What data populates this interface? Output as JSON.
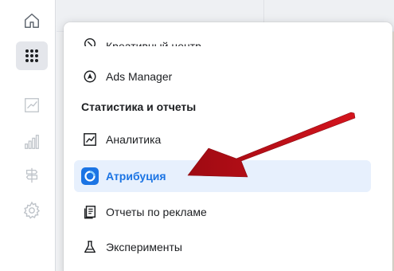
{
  "rail": {
    "icons": [
      "home-icon",
      "apps-grid-icon",
      "trend-chart-icon",
      "bar-chart-icon",
      "signpost-icon",
      "gear-icon"
    ]
  },
  "menu": {
    "cut_item_label": "Креативный центр",
    "ads_manager_label": "Ads Manager",
    "section_title": "Статистика и отчеты",
    "items": [
      {
        "label": "Аналитика",
        "icon": "line-chart-icon"
      },
      {
        "label": "Атрибуция",
        "icon": "attribution-icon",
        "selected": true
      },
      {
        "label": "Отчеты по рекламе",
        "icon": "report-icon"
      },
      {
        "label": "Эксперименты",
        "icon": "flask-icon"
      }
    ]
  },
  "colors": {
    "accent": "#1b74e4",
    "selected_bg": "#e7f0fd",
    "arrow": "#c8101a",
    "rail_icon_active": "#606770",
    "rail_icon_dim": "#bec3c9"
  }
}
